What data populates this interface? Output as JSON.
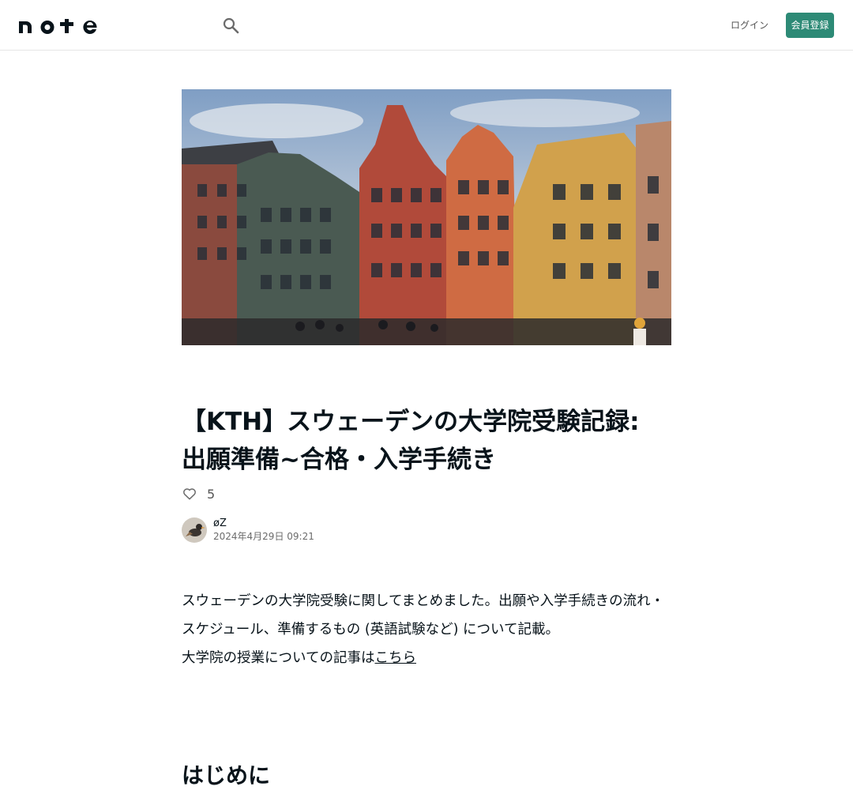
{
  "header": {
    "logo_text": "note",
    "search_icon": "search-icon",
    "login_label": "ログイン",
    "signup_label": "会員登録",
    "signup_color": "#2d8a76"
  },
  "hero": {
    "icon": "hero-image"
  },
  "article": {
    "title": "【KTH】スウェーデンの大学院受験記録: 出願準備~合格・入学手続き",
    "like_count": "5",
    "author_name": "øZ",
    "date": "2024年4月29日 09:21",
    "body_line1": "スウェーデンの大学院受験に関してまとめました。出願や入学手続きの流れ・スケジュール、準備するもの (英語試験など) について記載。",
    "body_line2_prefix": "大学院の授業についての記事は",
    "body_link": "こちら",
    "section_heading": "はじめに"
  }
}
